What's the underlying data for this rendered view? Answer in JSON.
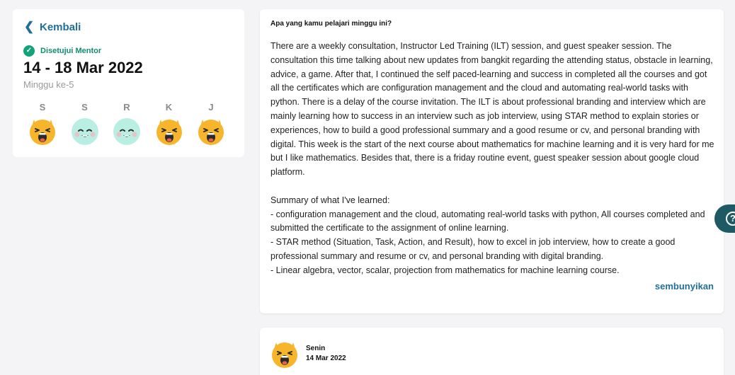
{
  "nav": {
    "back_label": "Kembali",
    "back_icon": "chevron-left-icon"
  },
  "week_summary": {
    "status": "Disetujui Mentor",
    "date_range": "14 - 18 Mar 2022",
    "week_label": "Minggu ke-5",
    "days": [
      {
        "label": "S",
        "mood": "excited"
      },
      {
        "label": "S",
        "mood": "content"
      },
      {
        "label": "R",
        "mood": "content"
      },
      {
        "label": "K",
        "mood": "excited"
      },
      {
        "label": "J",
        "mood": "excited"
      }
    ]
  },
  "journal": {
    "question": "Apa yang kamu pelajari minggu ini?",
    "answer": "There are a weekly consultation, Instructor Led Training (ILT) session, and guest speaker session. The consultation this time talking about new updates from bangkit regarding the attending status, obstacle in learning, advice, a game. After that, I continued the self paced-learning and success in completed all the courses and got all the certificates which are configuration management and the cloud and automating real-world tasks with python. There is a delay of the course invitation. The ILT is about professional branding and interview which are mainly learning how to success in an interview such as job interview, using STAR method to explain stories or experiences, how to build a good professional summary and a good resume or cv, and personal branding with digital. This week is the start of the next course about mathematics for machine learning and it is very hard for me but I like mathematics. Besides that, there is a friday routine event, guest speaker session about google cloud platform.\n\nSummary of what I've learned:\n- configuration management and the cloud, automating real-world tasks with python, All courses completed and submitted the certificate to the assignment of online learning.\n- STAR method (Situation, Task, Action, and Result), how to excel in job interview, how to create a good professional summary and resume or cv, and personal branding with digital branding.\n- Linear algebra, vector, scalar, projection from mathematics for machine learning course.",
    "hide_label": "sembunyikan"
  },
  "daily_entry": {
    "day": "Senin",
    "date": "14 Mar 2022",
    "mood": "excited"
  },
  "colors": {
    "accent": "#1f6f99",
    "approved": "#12a37a",
    "excited_face": "#f7b52c",
    "content_face": "#b9efe2",
    "help_button": "#1e5a63"
  },
  "help_icon": "help-question-icon"
}
